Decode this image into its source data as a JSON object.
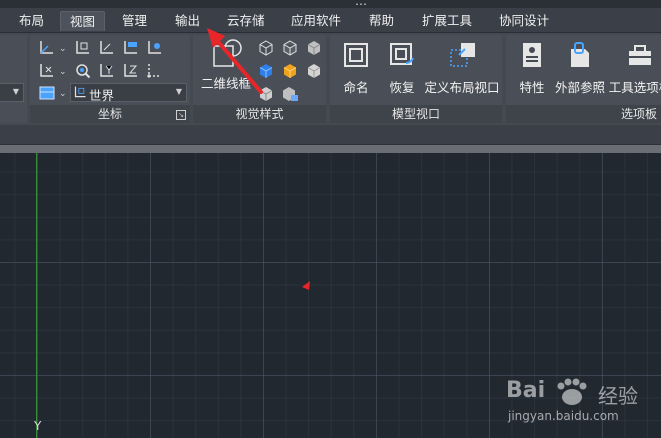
{
  "title": "…",
  "menu": {
    "tabs": [
      {
        "label": "布局",
        "active": false
      },
      {
        "label": "视图",
        "active": true
      },
      {
        "label": "管理",
        "active": false
      },
      {
        "label": "输出",
        "active": false
      },
      {
        "label": "云存储",
        "active": false
      },
      {
        "label": "应用软件",
        "active": false
      },
      {
        "label": "帮助",
        "active": false
      },
      {
        "label": "扩展工具",
        "active": false
      },
      {
        "label": "协同设计",
        "active": false
      }
    ]
  },
  "ribbon": {
    "coords_panel": {
      "title": "坐标",
      "ucs_combo_value": "世界"
    },
    "visual_styles_panel": {
      "title": "视觉样式",
      "style_button_label": "二维线框"
    },
    "model_viewport_panel": {
      "title": "模型视口",
      "buttons": [
        {
          "label": "命名",
          "icon": "named-viewports-icon"
        },
        {
          "label": "恢复",
          "icon": "restore-viewport-icon"
        },
        {
          "label": "定义布局视口",
          "icon": "define-layout-viewport-icon"
        }
      ]
    },
    "options_panel": {
      "title": "选项板",
      "buttons": [
        {
          "label": "特性",
          "icon": "properties-icon"
        },
        {
          "label": "外部参照",
          "icon": "xref-icon"
        },
        {
          "label": "工具选项板",
          "icon": "tool-palettes-icon"
        }
      ]
    }
  },
  "canvas": {
    "y_axis_label": "Y"
  },
  "watermark": {
    "brand": "Bai",
    "brand_suffix": "经验",
    "url": "jingyan.baidu.com"
  },
  "colors": {
    "canvas_bg": "#212830",
    "ribbon_bg": "#4a4f57",
    "annotation_red": "#e8262a",
    "y_axis_green": "#3c8a3c"
  }
}
